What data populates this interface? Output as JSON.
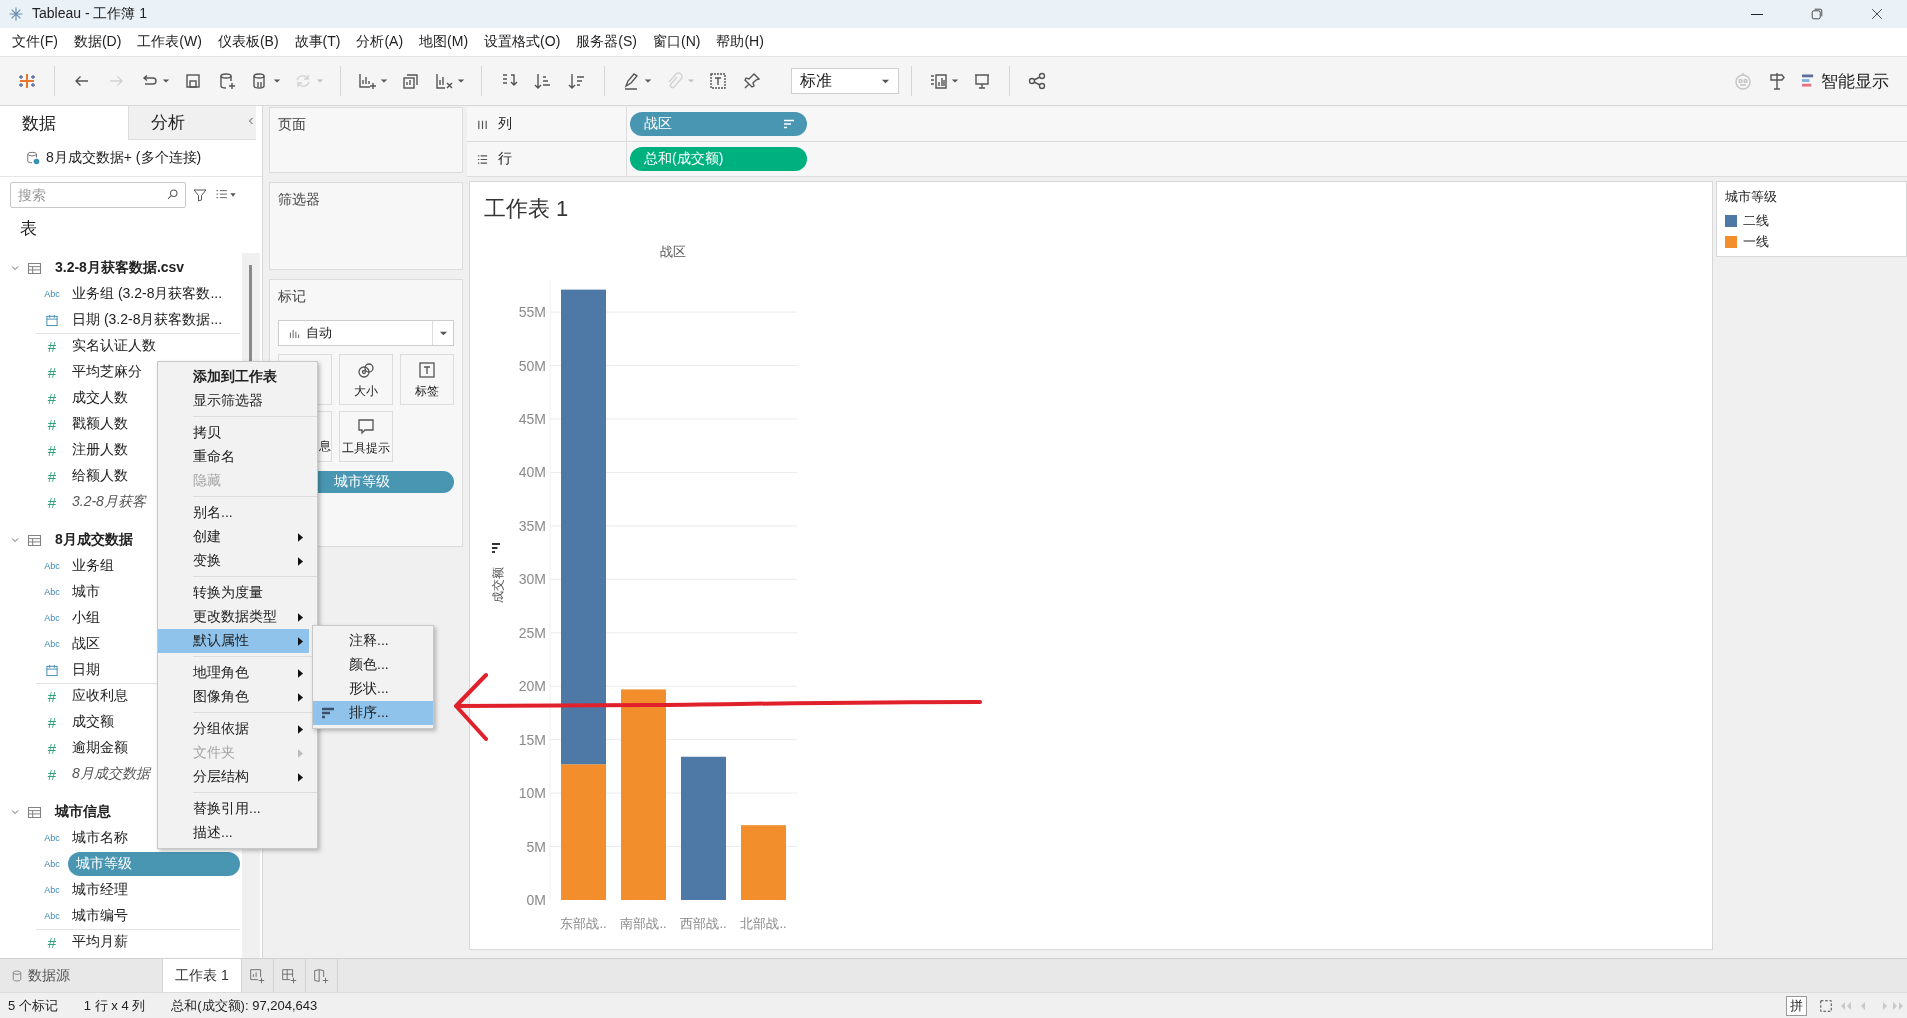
{
  "window": {
    "title": "Tableau - 工作簿 1"
  },
  "menu_bar": [
    "文件(F)",
    "数据(D)",
    "工作表(W)",
    "仪表板(B)",
    "故事(T)",
    "分析(A)",
    "地图(M)",
    "设置格式(O)",
    "服务器(S)",
    "窗口(N)",
    "帮助(H)"
  ],
  "toolbar": {
    "items": [
      {
        "kind": "button",
        "disabled": false,
        "dropdown": false
      },
      {
        "kind": "separator"
      },
      {
        "kind": "button",
        "disabled": false,
        "dropdown": false
      },
      {
        "kind": "button",
        "disabled": true,
        "dropdown": false
      },
      {
        "kind": "button",
        "disabled": false,
        "dropdown": true
      },
      {
        "kind": "button",
        "disabled": false,
        "dropdown": false
      },
      {
        "kind": "button",
        "disabled": false,
        "dropdown": false
      },
      {
        "kind": "button",
        "disabled": false,
        "dropdown": true
      },
      {
        "kind": "button",
        "disabled": true,
        "dropdown": true
      },
      {
        "kind": "separator"
      },
      {
        "kind": "button",
        "disabled": false,
        "dropdown": true
      },
      {
        "kind": "button",
        "disabled": false,
        "dropdown": false
      },
      {
        "kind": "button",
        "disabled": false,
        "dropdown": true
      },
      {
        "kind": "separator"
      },
      {
        "kind": "button",
        "disabled": false,
        "dropdown": false
      },
      {
        "kind": "button",
        "disabled": false,
        "dropdown": false
      },
      {
        "kind": "button",
        "disabled": false,
        "dropdown": false
      },
      {
        "kind": "separator"
      },
      {
        "kind": "button",
        "disabled": false,
        "dropdown": true
      },
      {
        "kind": "button",
        "disabled": true,
        "dropdown": true
      },
      {
        "kind": "button",
        "disabled": false,
        "dropdown": false
      },
      {
        "kind": "button",
        "disabled": false,
        "dropdown": false
      },
      {
        "kind": "select",
        "value": "标准"
      },
      {
        "kind": "separator"
      },
      {
        "kind": "button",
        "disabled": false,
        "dropdown": true
      },
      {
        "kind": "button",
        "disabled": false,
        "dropdown": false
      },
      {
        "kind": "separator"
      },
      {
        "kind": "button",
        "disabled": false,
        "dropdown": false
      }
    ],
    "right_items": [
      {
        "kind": "button",
        "disabled": true
      },
      {
        "kind": "button",
        "disabled": false
      },
      {
        "kind": "labeled",
        "label": "智能显示"
      }
    ]
  },
  "data_pane": {
    "tabs": [
      {
        "label": "数据",
        "selected": true
      },
      {
        "label": "分析",
        "selected": false
      }
    ],
    "data_source": "8月成交数据+ (多个连接)",
    "search": {
      "placeholder": "搜索"
    },
    "tables_heading": "表",
    "tables": [
      {
        "name": "3.2-8月获客数据.csv",
        "expanded": true,
        "fields": [
          {
            "name": "业务组 (3.2-8月获客数...",
            "kind": "dimension",
            "type_label": "Abc",
            "selected": false
          },
          {
            "name": "日期 (3.2-8月获客数据...",
            "kind": "date",
            "selected": false
          },
          {
            "name": "实名认证人数",
            "kind": "measure",
            "type_label": "#",
            "selected": false
          },
          {
            "name": "平均芝麻分",
            "kind": "measure",
            "type_label": "#",
            "selected": false
          },
          {
            "name": "成交人数",
            "kind": "measure",
            "type_label": "#",
            "selected": false
          },
          {
            "name": "戳额人数",
            "kind": "measure",
            "type_label": "#",
            "selected": false
          },
          {
            "name": "注册人数",
            "kind": "measure",
            "type_label": "#",
            "selected": false
          },
          {
            "name": "给额人数",
            "kind": "measure",
            "type_label": "#",
            "selected": false
          },
          {
            "name": "3.2-8月获客",
            "kind": "count",
            "type_label": "#",
            "selected": false
          }
        ]
      },
      {
        "name": "8月成交数据",
        "expanded": true,
        "fields": [
          {
            "name": "业务组",
            "kind": "dimension",
            "type_label": "Abc",
            "selected": false
          },
          {
            "name": "城市",
            "kind": "dimension",
            "type_label": "Abc",
            "selected": false
          },
          {
            "name": "小组",
            "kind": "dimension",
            "type_label": "Abc",
            "selected": false
          },
          {
            "name": "战区",
            "kind": "dimension",
            "type_label": "Abc",
            "selected": false
          },
          {
            "name": "日期",
            "kind": "date",
            "selected": false
          },
          {
            "name": "应收利息",
            "kind": "measure",
            "type_label": "#",
            "selected": false
          },
          {
            "name": "成交额",
            "kind": "measure",
            "type_label": "#",
            "selected": false
          },
          {
            "name": "逾期金额",
            "kind": "measure",
            "type_label": "#",
            "selected": false
          },
          {
            "name": "8月成交数据",
            "kind": "count",
            "type_label": "#",
            "selected": false
          }
        ]
      },
      {
        "name": "城市信息",
        "expanded": true,
        "fields": [
          {
            "name": "城市名称",
            "kind": "dimension",
            "type_label": "Abc",
            "selected": false
          },
          {
            "name": "城市等级",
            "kind": "dimension",
            "type_label": "Abc",
            "selected": true
          },
          {
            "name": "城市经理",
            "kind": "dimension",
            "type_label": "Abc",
            "selected": false
          },
          {
            "name": "城市编号",
            "kind": "dimension",
            "type_label": "Abc",
            "selected": false
          },
          {
            "name": "平均月薪",
            "kind": "measure",
            "type_label": "#",
            "selected": false
          }
        ]
      }
    ]
  },
  "pages_shelf": {
    "title": "页面"
  },
  "filters_shelf": {
    "title": "筛选器"
  },
  "marks": {
    "title": "标记",
    "mark_type": "自动",
    "buttons": [
      {
        "kind": "size",
        "label": "大小"
      },
      {
        "kind": "label",
        "label": "标签"
      },
      {
        "kind": "detail",
        "label": "息"
      },
      {
        "kind": "tooltip",
        "label": "工具提示"
      }
    ],
    "pills": [
      {
        "label": "城市等级",
        "kind": "dimension"
      }
    ]
  },
  "columns_shelf": {
    "label": "列",
    "pills": [
      {
        "label": "战区",
        "kind": "dimension",
        "sorted": true
      }
    ]
  },
  "rows_shelf": {
    "label": "行",
    "pills": [
      {
        "label": "总和(成交额)",
        "kind": "measure",
        "sorted": false
      }
    ]
  },
  "sheet": {
    "title": "工作表 1",
    "chart_data": {
      "type": "bar",
      "stacked": true,
      "grid": true,
      "xlabel": "战区",
      "ylabel": "成交额",
      "categories": [
        "东部战..",
        "南部战..",
        "西部战..",
        "北部战.."
      ],
      "series": [
        {
          "name": "一线",
          "color": "#f28e2b",
          "values": [
            12.7,
            19.7,
            null,
            7.0
          ]
        },
        {
          "name": "二线",
          "color": "#4e79a7",
          "values": [
            44.4,
            null,
            13.4,
            null
          ]
        }
      ],
      "ylim": [
        0,
        58
      ],
      "yticks": [
        {
          "value": 0,
          "label": "0M"
        },
        {
          "value": 5,
          "label": "5M"
        },
        {
          "value": 10,
          "label": "10M"
        },
        {
          "value": 15,
          "label": "15M"
        },
        {
          "value": 20,
          "label": "20M"
        },
        {
          "value": 25,
          "label": "25M"
        },
        {
          "value": 30,
          "label": "30M"
        },
        {
          "value": 35,
          "label": "35M"
        },
        {
          "value": 40,
          "label": "40M"
        },
        {
          "value": 45,
          "label": "45M"
        },
        {
          "value": 50,
          "label": "50M"
        },
        {
          "value": 55,
          "label": "55M"
        }
      ]
    }
  },
  "legend": {
    "title": "城市等级"
  },
  "context_menu": {
    "items": [
      {
        "kind": "item",
        "label": "添加到工作表",
        "bold": true,
        "submenu": false,
        "disabled": false,
        "selected": false
      },
      {
        "kind": "item",
        "label": "显示筛选器",
        "bold": false,
        "submenu": false,
        "disabled": false,
        "selected": false
      },
      {
        "kind": "separator"
      },
      {
        "kind": "item",
        "label": "拷贝",
        "bold": false,
        "submenu": false,
        "disabled": false,
        "selected": false
      },
      {
        "kind": "item",
        "label": "重命名",
        "bold": false,
        "submenu": false,
        "disabled": false,
        "selected": false
      },
      {
        "kind": "item",
        "label": "隐藏",
        "bold": false,
        "submenu": false,
        "disabled": true,
        "selected": false
      },
      {
        "kind": "separator"
      },
      {
        "kind": "item",
        "label": "别名...",
        "bold": false,
        "submenu": false,
        "disabled": false,
        "selected": false
      },
      {
        "kind": "item",
        "label": "创建",
        "bold": false,
        "submenu": true,
        "disabled": false,
        "selected": false
      },
      {
        "kind": "item",
        "label": "变换",
        "bold": false,
        "submenu": true,
        "disabled": false,
        "selected": false
      },
      {
        "kind": "separator"
      },
      {
        "kind": "item",
        "label": "转换为度量",
        "bold": false,
        "submenu": false,
        "disabled": false,
        "selected": false
      },
      {
        "kind": "item",
        "label": "更改数据类型",
        "bold": false,
        "submenu": true,
        "disabled": false,
        "selected": false
      },
      {
        "kind": "item",
        "label": "默认属性",
        "bold": false,
        "submenu": true,
        "disabled": false,
        "selected": true
      },
      {
        "kind": "separator"
      },
      {
        "kind": "item",
        "label": "地理角色",
        "bold": false,
        "submenu": true,
        "disabled": false,
        "selected": false
      },
      {
        "kind": "item",
        "label": "图像角色",
        "bold": false,
        "submenu": true,
        "disabled": false,
        "selected": false
      },
      {
        "kind": "separator"
      },
      {
        "kind": "item",
        "label": "分组依据",
        "bold": false,
        "submenu": true,
        "disabled": false,
        "selected": false
      },
      {
        "kind": "item",
        "label": "文件夹",
        "bold": false,
        "submenu": true,
        "disabled": true,
        "selected": false
      },
      {
        "kind": "item",
        "label": "分层结构",
        "bold": false,
        "submenu": true,
        "disabled": false,
        "selected": false
      },
      {
        "kind": "separator"
      },
      {
        "kind": "item",
        "label": "替换引用...",
        "bold": false,
        "submenu": false,
        "disabled": false,
        "selected": false
      },
      {
        "kind": "item",
        "label": "描述...",
        "bold": false,
        "submenu": false,
        "disabled": false,
        "selected": false
      }
    ]
  },
  "submenu": {
    "items": [
      {
        "kind": "item",
        "label": "注释...",
        "selected": false
      },
      {
        "kind": "item",
        "label": "颜色...",
        "selected": false
      },
      {
        "kind": "item",
        "label": "形状...",
        "selected": false
      },
      {
        "kind": "sort",
        "label": "排序...",
        "selected": true
      }
    ]
  },
  "sheet_tabs": [
    {
      "kind": "data_source",
      "label": "数据源",
      "selected": false
    },
    {
      "kind": "sheet",
      "label": "工作表 1",
      "selected": true
    }
  ],
  "status_bar": {
    "marks": "5 个标记",
    "grid": "1 行 x 4 列",
    "sum": "总和(成交额): 97,204,643",
    "ime": "拼"
  }
}
